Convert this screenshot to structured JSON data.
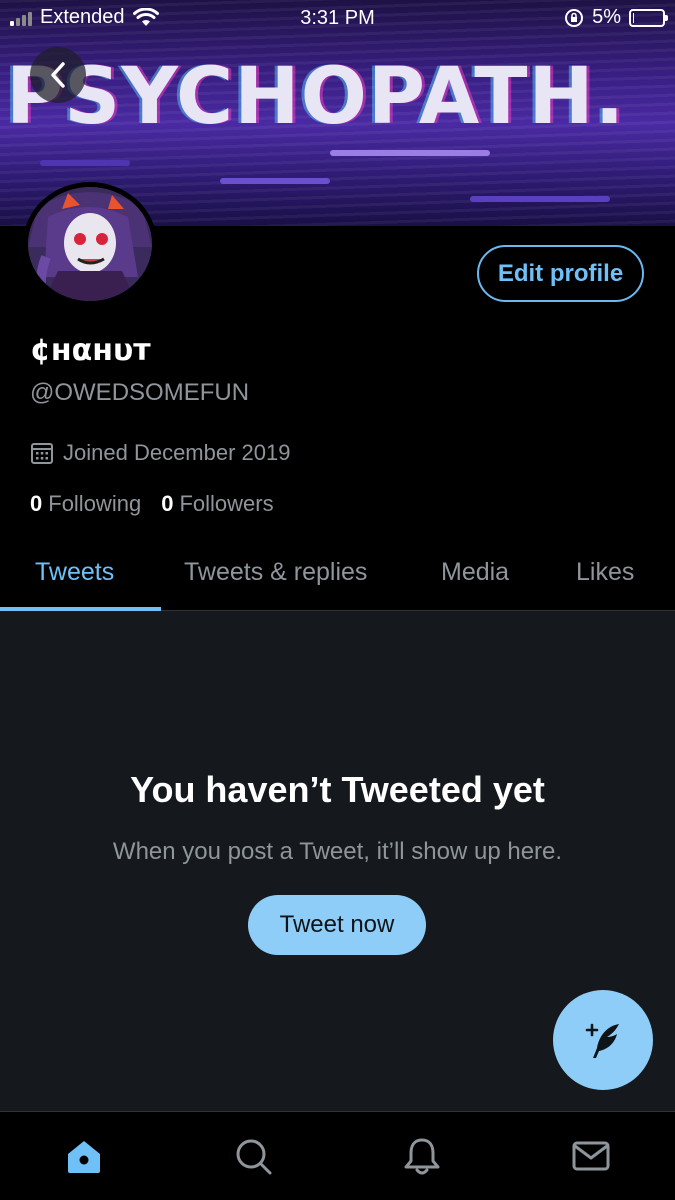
{
  "status_bar": {
    "carrier": "Extended",
    "time": "3:31 PM",
    "battery": "5%",
    "battery_level": 0.05
  },
  "banner": {
    "text": "PSYCHOPATH."
  },
  "profile": {
    "display_name": "¢нαнυт",
    "handle": "@OWEDSOMEFUN",
    "joined": "Joined December 2019",
    "following_count": "0",
    "following_label": "Following",
    "followers_count": "0",
    "followers_label": "Followers",
    "edit_profile_label": "Edit profile"
  },
  "tabs": [
    {
      "label": "Tweets",
      "active": true
    },
    {
      "label": "Tweets & replies",
      "active": false
    },
    {
      "label": "Media",
      "active": false
    },
    {
      "label": "Likes",
      "active": false
    }
  ],
  "empty_state": {
    "title": "You haven’t Tweeted yet",
    "subtitle": "When you post a Tweet, it’ll show up here.",
    "button_label": "Tweet now"
  },
  "bottom_nav": [
    {
      "icon": "home-icon",
      "active": true
    },
    {
      "icon": "search-icon",
      "active": false
    },
    {
      "icon": "bell-icon",
      "active": false
    },
    {
      "icon": "mail-icon",
      "active": false
    }
  ],
  "colors": {
    "accent": "#6fc0f7",
    "button_fill": "#8ecdf7",
    "muted_text": "#8e959b",
    "content_bg": "#15181c"
  }
}
